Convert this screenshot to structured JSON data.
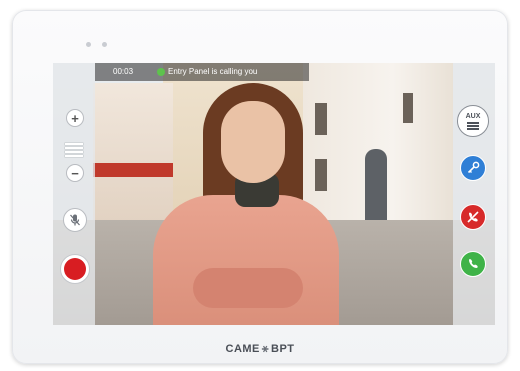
{
  "call": {
    "timer": "00:03",
    "status": "Entry Panel is calling you",
    "status_color": "#5ec24d"
  },
  "controls": {
    "volume_up_symbol": "+",
    "volume_down_symbol": "−",
    "aux_label": "AUX"
  },
  "icons": {
    "volume_up": "plus-icon",
    "volume_down": "minus-icon",
    "volume_level": "volume-bars-icon",
    "mute": "microphone-mute-icon",
    "record": "record-icon",
    "aux": "list-icon",
    "door_release": "key-icon",
    "hang_up": "phone-hangup-icon",
    "answer": "phone-answer-icon"
  },
  "colors": {
    "record": "#d81d22",
    "door_release": "#2f7fd6",
    "hang_up": "#d72a2a",
    "answer": "#3fb348"
  },
  "brand": {
    "left": "CAME",
    "right": "BPT"
  }
}
